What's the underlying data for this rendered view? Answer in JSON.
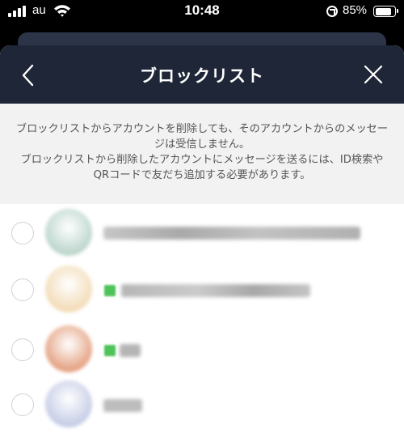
{
  "status_bar": {
    "carrier": "au",
    "time": "10:48",
    "battery_pct": "85%",
    "battery_level": 0.85
  },
  "header": {
    "title": "ブロックリスト",
    "back_icon": "chevron-left-icon",
    "close_icon": "close-icon"
  },
  "notice": {
    "line1": "ブロックリストからアカウントを削除しても、そのアカウントからのメッセージは受信しません。",
    "line2": "ブロックリストから削除したアカウントにメッセージを送るには、ID検索やQRコードで友だち追加する必要があります。"
  },
  "colors": {
    "header_bg": "#1f2638",
    "notice_bg": "#f2f2f3",
    "badge_green": "#4fc35a"
  },
  "blocked_accounts": [
    {
      "avatar_color": "#bcd6cc",
      "name_redacted": true,
      "has_badge": false
    },
    {
      "avatar_color": "#f3dcb8",
      "name_redacted": true,
      "has_badge": true
    },
    {
      "avatar_color": "#e5a384",
      "name_redacted": true,
      "has_badge": true
    },
    {
      "avatar_color": "#c6cde6",
      "name_redacted": true,
      "has_badge": false
    }
  ]
}
